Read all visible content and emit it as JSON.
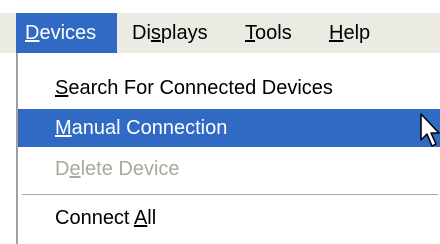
{
  "menubar": {
    "items": [
      {
        "id": "devices",
        "label": "Devices",
        "mnemonic": "D",
        "rest": "evices",
        "active": true
      },
      {
        "id": "displays",
        "label": "Displays",
        "pre": "Di",
        "mnemonic": "s",
        "rest": "plays",
        "active": false
      },
      {
        "id": "tools",
        "label": "Tools",
        "mnemonic": "T",
        "rest": "ools",
        "active": false
      },
      {
        "id": "help",
        "label": "Help",
        "mnemonic": "H",
        "rest": "elp",
        "active": false
      }
    ]
  },
  "dropdown": {
    "items": [
      {
        "label": "Search For Connected Devices",
        "mnemonic": "S",
        "rest": "earch For Connected Devices",
        "state": "normal"
      },
      {
        "label": "Manual Connection",
        "mnemonic": "M",
        "rest": "anual Connection",
        "state": "highlighted"
      },
      {
        "label": "Delete Device",
        "pre": "D",
        "mnemonic": "e",
        "rest": "lete Device",
        "state": "disabled"
      },
      {
        "label": "Connect All",
        "pre": "Connect ",
        "mnemonic": "A",
        "rest": "ll",
        "state": "normal"
      }
    ]
  },
  "colors": {
    "highlight": "#316ac5",
    "menubar_bg": "#ecebe3",
    "disabled_text": "#aca899"
  },
  "cursor": {
    "icon": "arrow-pointer-icon"
  }
}
